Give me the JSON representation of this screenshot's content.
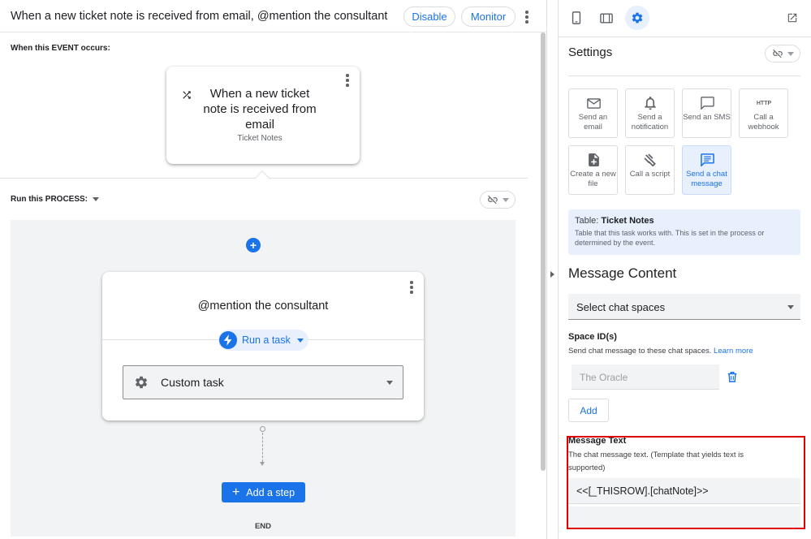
{
  "header": {
    "title": "When a new ticket note is received from email, @mention the consultant",
    "disable_label": "Disable",
    "monitor_label": "Monitor"
  },
  "event": {
    "section_label": "When this EVENT occurs:",
    "card_title": "When a new ticket note is received from email",
    "card_subtitle": "Ticket Notes"
  },
  "process": {
    "section_label": "Run this PROCESS:",
    "step_title": "@mention the consultant",
    "run_task_label": "Run a task",
    "task_select_value": "Custom task",
    "add_step_label": "Add a step",
    "end_label": "END"
  },
  "settings": {
    "title": "Settings",
    "tiles": [
      {
        "label": "Send an email",
        "icon": "mail-icon"
      },
      {
        "label": "Send a notification",
        "icon": "bell-icon"
      },
      {
        "label": "Send an SMS",
        "icon": "sms-icon"
      },
      {
        "label": "Call a webhook",
        "icon": "http-icon",
        "icon_text": "HTTP"
      },
      {
        "label": "Create a new file",
        "icon": "file-add-icon"
      },
      {
        "label": "Call a script",
        "icon": "script-icon"
      },
      {
        "label": "Send a chat message",
        "icon": "chat-icon",
        "selected": true
      }
    ],
    "table_prefix": "Table:",
    "table_name": "Ticket Notes",
    "table_desc": "Table that this task works with. This is set in the process or determined by the event."
  },
  "message_content": {
    "title": "Message Content",
    "select_value": "Select chat spaces",
    "space_label": "Space ID(s)",
    "space_desc": "Send chat message to these chat spaces.",
    "learn_more": "Learn more",
    "space_value": "The Oracle",
    "add_label": "Add",
    "message_text_label": "Message Text",
    "message_text_desc": "The chat message text. (Template that yields text is supported)",
    "message_text_value": "<<[_THISROW].[chatNote]>>"
  },
  "colors": {
    "accent": "#1a73e8",
    "highlight": "#e00000"
  }
}
